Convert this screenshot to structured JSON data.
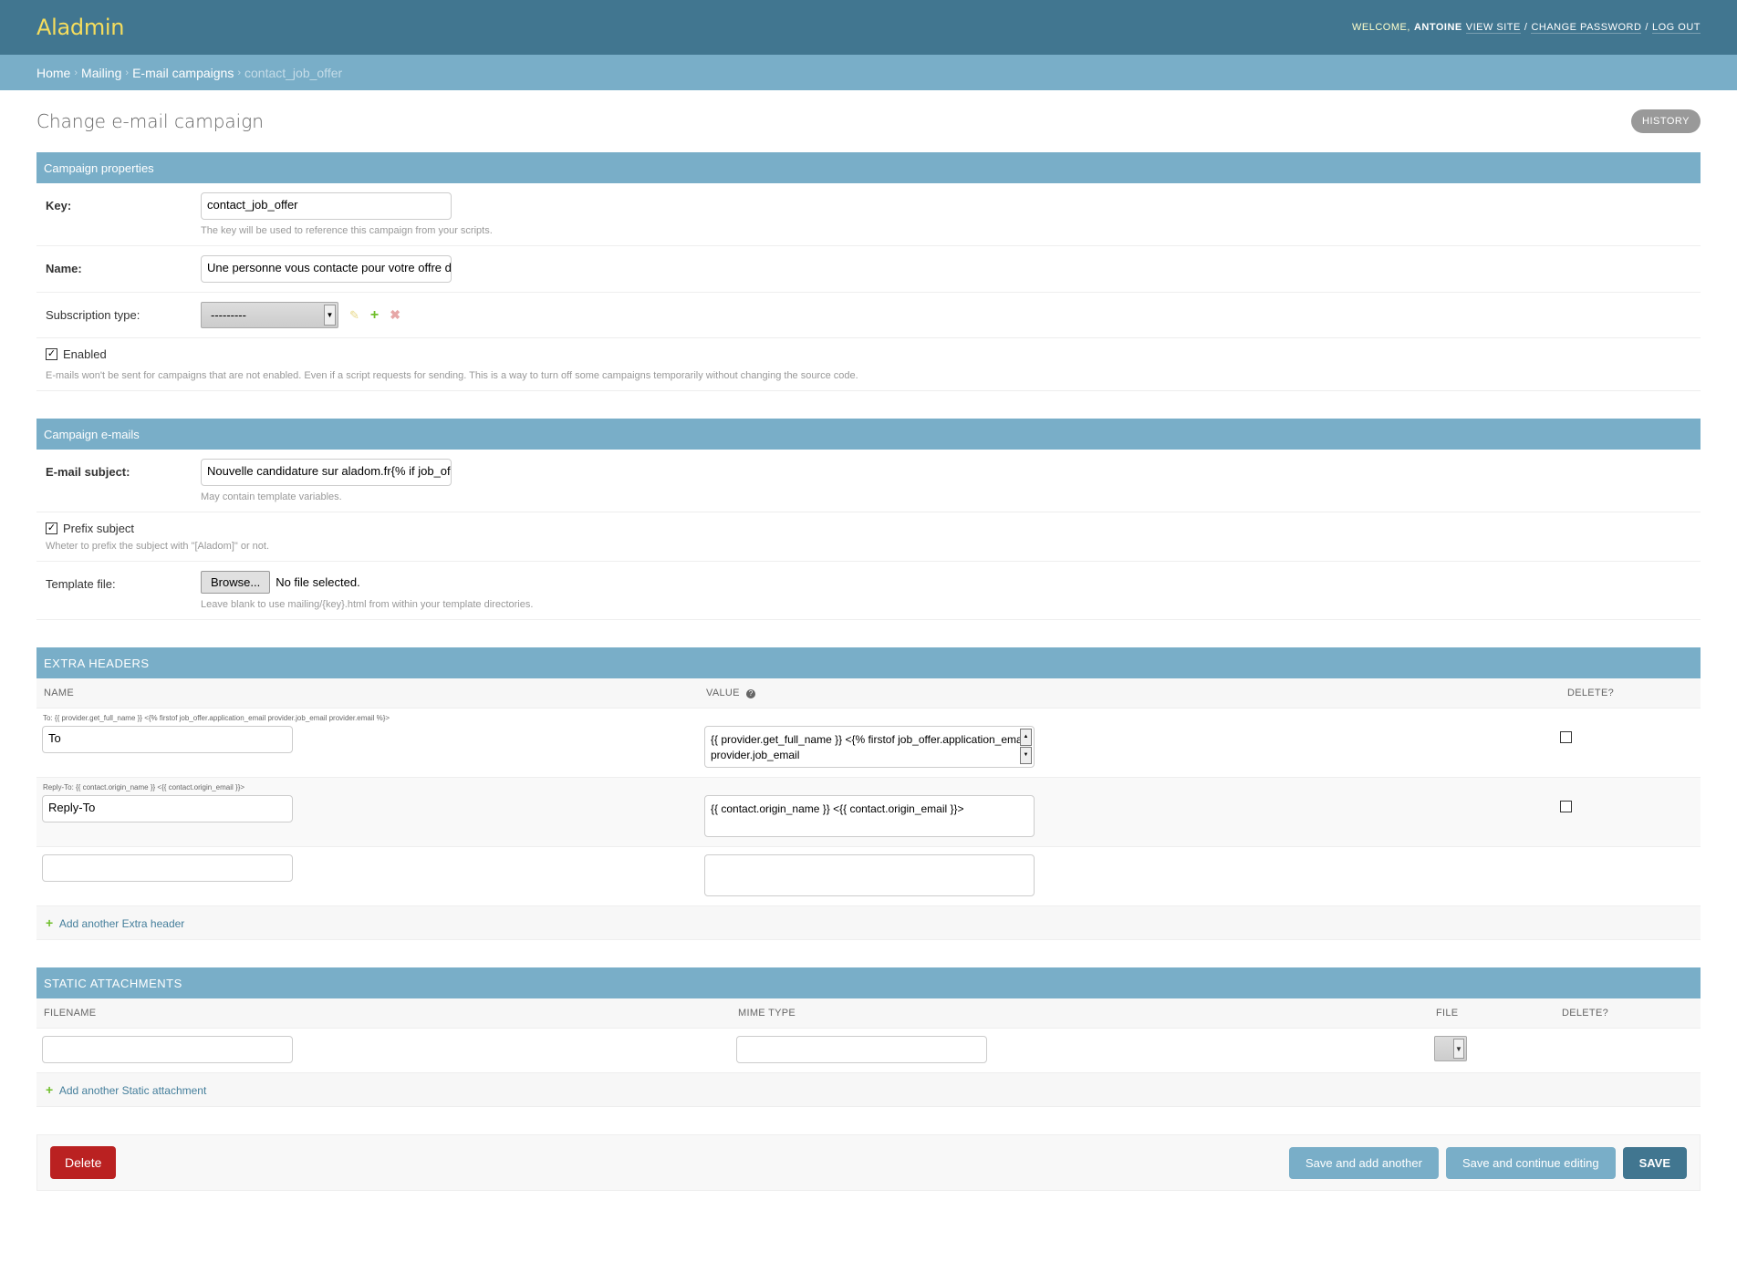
{
  "header": {
    "brand": "Aladmin",
    "welcome": "Welcome,",
    "username": "Antoine",
    "view_site": "View site",
    "change_password": "Change password",
    "log_out": "Log out",
    "sep": "/"
  },
  "breadcrumbs": {
    "home": "Home",
    "mailing": "Mailing",
    "campaigns": "E-mail campaigns",
    "current": "contact_job_offer",
    "sep": "›"
  },
  "page": {
    "title": "Change e-mail campaign",
    "history": "History"
  },
  "campaign_properties": {
    "heading": "Campaign properties",
    "key_label": "Key:",
    "key_value": "contact_job_offer",
    "key_help": "The key will be used to reference this campaign from your scripts.",
    "name_label": "Name:",
    "name_value": "Une personne vous contacte pour votre offre d",
    "subscription_label": "Subscription type:",
    "subscription_value": "---------",
    "enabled_label": "Enabled",
    "enabled_checked": "✓",
    "enabled_help": "E-mails won't be sent for campaigns that are not enabled. Even if a script requests for sending. This is a way to turn off some campaigns temporarily without changing the source code."
  },
  "campaign_emails": {
    "heading": "Campaign e-mails",
    "subject_label": "E-mail subject:",
    "subject_value": "Nouvelle candidature sur aladom.fr{% if job_of",
    "subject_help": "May contain template variables.",
    "prefix_label": "Prefix subject",
    "prefix_checked": "✓",
    "prefix_help": "Wheter to prefix the subject with \"[Aladom]\" or not.",
    "template_label": "Template file:",
    "browse_label": "Browse...",
    "no_file": "No file selected.",
    "template_help": "Leave blank to use mailing/{key}.html from within your template directories."
  },
  "extra_headers": {
    "heading": "Extra headers",
    "col_name": "Name",
    "col_value": "Value",
    "col_delete": "Delete?",
    "rows": [
      {
        "original": "To: {{ provider.get_full_name }} <{% firstof job_offer.application_email provider.job_email provider.email %}>",
        "name": "To",
        "value": "{{ provider.get_full_name }} <{% firstof job_offer.application_email provider.job_email"
      },
      {
        "original": "Reply-To: {{ contact.origin_name }} <{{ contact.origin_email }}>",
        "name": "Reply-To",
        "value": "{{ contact.origin_name }} <{{ contact.origin_email }}>"
      },
      {
        "original": "",
        "name": "",
        "value": ""
      }
    ],
    "add_label": "Add another Extra header"
  },
  "static_attachments": {
    "heading": "Static attachments",
    "col_filename": "Filename",
    "col_mime": "Mime type",
    "col_file": "File",
    "col_delete": "Delete?",
    "add_label": "Add another Static attachment"
  },
  "submit": {
    "delete": "Delete",
    "save_add": "Save and add another",
    "save_continue": "Save and continue editing",
    "save": "Save"
  },
  "icons": {
    "plus": "+",
    "edit": "✎",
    "remove": "✖",
    "help": "?",
    "arrow_down": "▼",
    "arrow_up": "▲"
  }
}
